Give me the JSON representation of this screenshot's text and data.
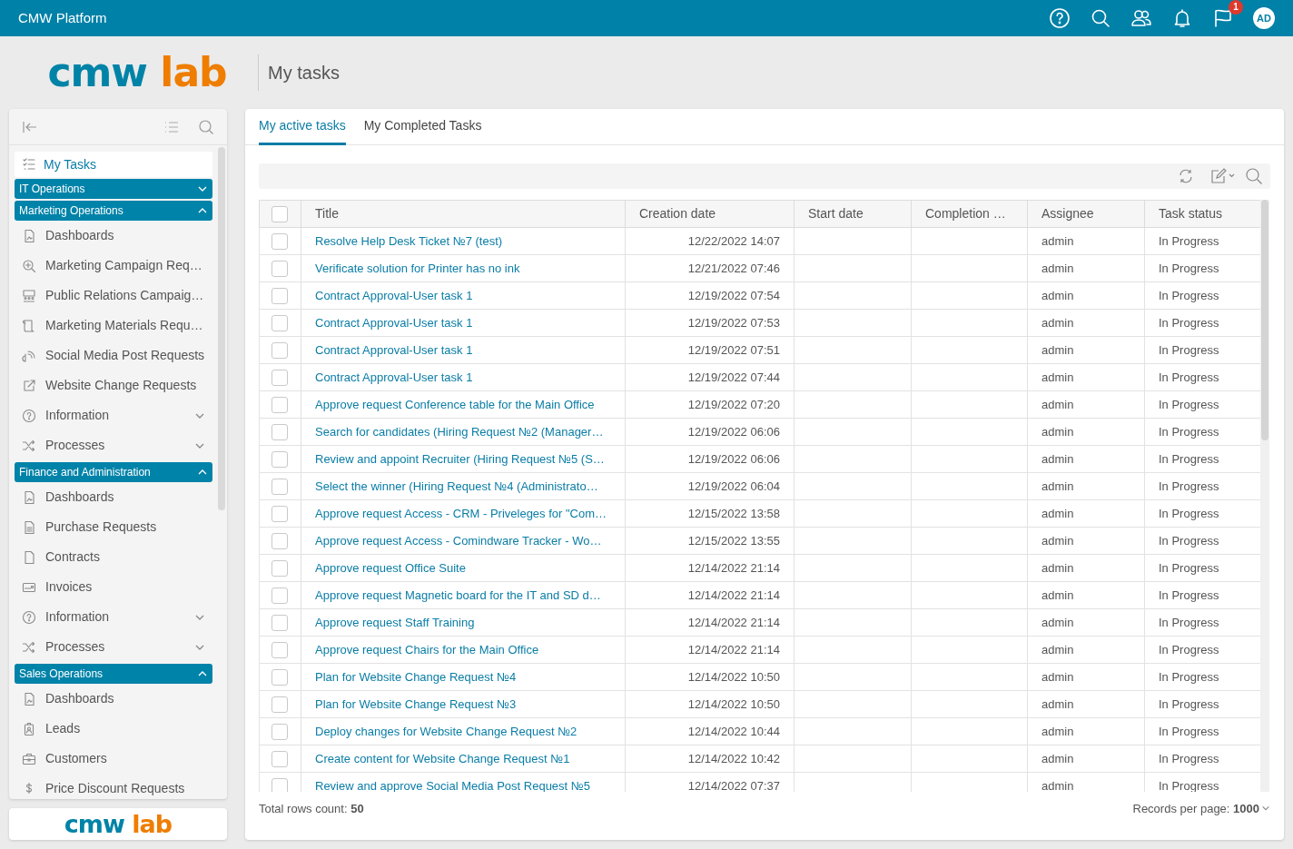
{
  "topbar": {
    "title": "CMW Platform",
    "notifications": "1",
    "avatar": "AD"
  },
  "header": {
    "logo": {
      "primary": "cmw",
      "accent": "lab"
    },
    "title": "My tasks"
  },
  "sidebar": {
    "my_tasks": {
      "label": "My Tasks",
      "selected": true
    },
    "groups": [
      {
        "label": "IT Operations",
        "expanded": false
      },
      {
        "label": "Marketing Operations",
        "expanded": true,
        "children": [
          {
            "label": "Dashboards",
            "kind": "page"
          },
          {
            "label": "Marketing Campaign Req…",
            "kind": "page"
          },
          {
            "label": "Public Relations Campaig…",
            "kind": "page"
          },
          {
            "label": "Marketing Materials Requ…",
            "kind": "page"
          },
          {
            "label": "Social Media Post Requests",
            "kind": "page"
          },
          {
            "label": "Website Change Requests",
            "kind": "page"
          },
          {
            "label": "Information",
            "kind": "folder",
            "expanded": false
          },
          {
            "label": "Processes",
            "kind": "folder",
            "expanded": false
          }
        ]
      },
      {
        "label": "Finance and Administration",
        "expanded": true,
        "children": [
          {
            "label": "Dashboards",
            "kind": "page"
          },
          {
            "label": "Purchase Requests",
            "kind": "page"
          },
          {
            "label": "Contracts",
            "kind": "page"
          },
          {
            "label": "Invoices",
            "kind": "page"
          },
          {
            "label": "Information",
            "kind": "folder",
            "expanded": false
          },
          {
            "label": "Processes",
            "kind": "folder",
            "expanded": false
          }
        ]
      },
      {
        "label": "Sales Operations",
        "expanded": true,
        "children": [
          {
            "label": "Dashboards",
            "kind": "page"
          },
          {
            "label": "Leads",
            "kind": "page"
          },
          {
            "label": "Customers",
            "kind": "page"
          },
          {
            "label": "Price Discount Requests",
            "kind": "page"
          }
        ]
      }
    ]
  },
  "sidebar_footer": {
    "logo": {
      "primary": "cmw",
      "accent": "lab"
    }
  },
  "tabs": [
    {
      "label": "My active tasks",
      "selected": true
    },
    {
      "label": "My Completed Tasks",
      "selected": false
    }
  ],
  "table": {
    "select_all_checked": false,
    "columns": [
      "Title",
      "Creation date",
      "Start date",
      "Completion …",
      "Assignee",
      "Task status"
    ],
    "rows": [
      {
        "checked": false,
        "title": "Resolve Help Desk Ticket №7 (test)",
        "created": "12/22/2022 14:07",
        "assignee": "admin",
        "status": "In Progress"
      },
      {
        "checked": false,
        "title": "Verificate solution for Printer has no ink",
        "created": "12/21/2022 07:46",
        "assignee": "admin",
        "status": "In Progress"
      },
      {
        "checked": false,
        "title": "Contract Approval-User task 1",
        "created": "12/19/2022 07:54",
        "assignee": "admin",
        "status": "In Progress"
      },
      {
        "checked": false,
        "title": "Contract Approval-User task 1",
        "created": "12/19/2022 07:53",
        "assignee": "admin",
        "status": "In Progress"
      },
      {
        "checked": false,
        "title": "Contract Approval-User task 1",
        "created": "12/19/2022 07:51",
        "assignee": "admin",
        "status": "In Progress"
      },
      {
        "checked": false,
        "title": "Contract Approval-User task 1",
        "created": "12/19/2022 07:44",
        "assignee": "admin",
        "status": "In Progress"
      },
      {
        "checked": false,
        "title": "Approve request Conference table for the Main Office",
        "created": "12/19/2022 07:20",
        "assignee": "admin",
        "status": "In Progress"
      },
      {
        "checked": false,
        "title": "Search for candidates (Hiring Request №2 (Manager…",
        "created": "12/19/2022 06:06",
        "assignee": "admin",
        "status": "In Progress"
      },
      {
        "checked": false,
        "title": "Review and appoint Recruiter (Hiring Request №5 (S…",
        "created": "12/19/2022 06:06",
        "assignee": "admin",
        "status": "In Progress"
      },
      {
        "checked": false,
        "title": "Select the winner (Hiring Request №4 (Administrato…",
        "created": "12/19/2022 06:04",
        "assignee": "admin",
        "status": "In Progress"
      },
      {
        "checked": false,
        "title": "Approve request Access - CRM - Priveleges for \"Com…",
        "created": "12/15/2022 13:58",
        "assignee": "admin",
        "status": "In Progress"
      },
      {
        "checked": false,
        "title": "Approve request Access - Comindware Tracker - Wo…",
        "created": "12/15/2022 13:55",
        "assignee": "admin",
        "status": "In Progress"
      },
      {
        "checked": false,
        "title": "Approve request Office Suite",
        "created": "12/14/2022 21:14",
        "assignee": "admin",
        "status": "In Progress"
      },
      {
        "checked": false,
        "title": "Approve request Magnetic board for the IT and SD d…",
        "created": "12/14/2022 21:14",
        "assignee": "admin",
        "status": "In Progress"
      },
      {
        "checked": false,
        "title": "Approve request Staff Training",
        "created": "12/14/2022 21:14",
        "assignee": "admin",
        "status": "In Progress"
      },
      {
        "checked": false,
        "title": "Approve request Chairs for the Main Office",
        "created": "12/14/2022 21:14",
        "assignee": "admin",
        "status": "In Progress"
      },
      {
        "checked": false,
        "title": "Plan for Website Change Request №4",
        "created": "12/14/2022 10:50",
        "assignee": "admin",
        "status": "In Progress"
      },
      {
        "checked": false,
        "title": "Plan for Website Change Request №3",
        "created": "12/14/2022 10:50",
        "assignee": "admin",
        "status": "In Progress"
      },
      {
        "checked": false,
        "title": "Deploy changes for Website Change Request №2",
        "created": "12/14/2022 10:44",
        "assignee": "admin",
        "status": "In Progress"
      },
      {
        "checked": false,
        "title": "Create content for Website Change Request №1",
        "created": "12/14/2022 10:42",
        "assignee": "admin",
        "status": "In Progress"
      },
      {
        "checked": false,
        "title": "Review and approve Social Media Post Request №5",
        "created": "12/14/2022 07:37",
        "assignee": "admin",
        "status": "In Progress"
      }
    ]
  },
  "footer": {
    "total": "Total rows count: **50**",
    "per_page": "Records per page: **1000**"
  }
}
